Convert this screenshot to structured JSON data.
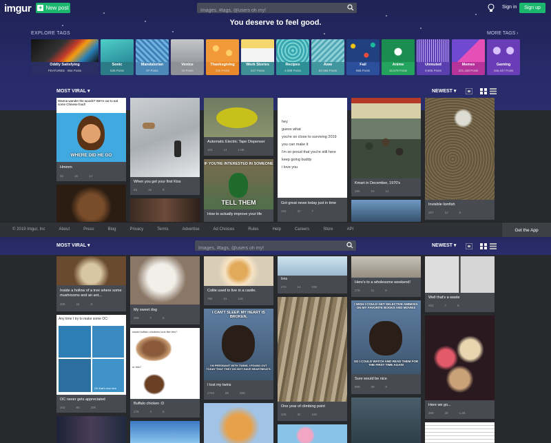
{
  "topbar": {
    "logo": "imgur",
    "new_post_label": "New post",
    "search_placeholder": "Images, #tags, @users oh my!",
    "sign_in": "Sign in",
    "sign_up": "Sign up"
  },
  "hero": {
    "tagline": "You deserve to feel good.",
    "explore_label": "EXPLORE TAGS",
    "more_tags_label": "MORE TAGS"
  },
  "tags": [
    {
      "label": "Oddly Satisfying",
      "count": "FEATURED · 864 Posts",
      "color": "#2a2f63"
    },
    {
      "label": "Sonic",
      "count": "535 Posts",
      "color": "#2c7c87"
    },
    {
      "label": "Mandalorian",
      "count": "97 Posts",
      "color": "#4c89b9"
    },
    {
      "label": "Venice",
      "count": "15 Posts",
      "color": "#8e9196"
    },
    {
      "label": "Thanksgiving",
      "count": "226 Posts",
      "color": "#e98a2a"
    },
    {
      "label": "Work Stories",
      "count": "247 Posts",
      "color": "#3f9096"
    },
    {
      "label": "Recipes",
      "count": "4,898 Posts",
      "color": "#2e8f97"
    },
    {
      "label": "Aww",
      "count": "50,566 Posts",
      "color": "#4196a0"
    },
    {
      "label": "Fail",
      "count": "868 Posts",
      "color": "#2b4f9a"
    },
    {
      "label": "Anime",
      "count": "16,579 Posts",
      "color": "#24a35f"
    },
    {
      "label": "Unmuted",
      "count": "9,805 Posts",
      "color": "#5a3fb0"
    },
    {
      "label": "Memes",
      "count": "221,158 Posts",
      "color": "#b5339b"
    },
    {
      "label": "Gaming",
      "count": "156,447 Posts",
      "color": "#6a3cb6"
    }
  ],
  "sort": {
    "most_viral": "MOST VIRAL",
    "newest": "NEWEST"
  },
  "footer": {
    "links": [
      "© 2019 Imgur, Inc",
      "About",
      "Press",
      "Blog",
      "Privacy",
      "Terms",
      "Advertise",
      "Ad Choices",
      "Rules",
      "Help",
      "Careers",
      "Store",
      "API"
    ],
    "get_app": "Get the App"
  },
  "posts": {
    "c1a": {
      "title": "Hmmm",
      "meta": [
        "92",
        "16",
        "14"
      ]
    },
    "c2a": {
      "title": "When you get your first Kiss",
      "meta": [
        "63",
        "16",
        "9"
      ]
    },
    "c3a": {
      "title": "Automatic Electric Tape Dispenser",
      "meta": [
        "103",
        "14",
        "1.9K"
      ]
    },
    "c3b": {
      "title": "How to actually improve your life",
      "meta": [
        "141",
        "40",
        "6"
      ]
    },
    "c4a": {
      "title": "Got great news today just in time",
      "meta": [
        "102",
        "31",
        "7"
      ]
    },
    "c5a": {
      "title": "Kmart in December, 1970's",
      "meta": [
        "290",
        "15",
        "14"
      ]
    },
    "c6a": {
      "title": "Invisible lionfish",
      "meta": [
        "257",
        "12",
        "8"
      ]
    },
    "c1b": {
      "title": "Inside a hollow of a tree where some mushrooms and an ant...",
      "meta": [
        "406",
        "22",
        "8"
      ]
    },
    "c2b": {
      "title": "My sweet dog",
      "meta": [
        "309",
        "7",
        "6"
      ]
    },
    "c3c": {
      "title": "Collie used to live in a castle.",
      "meta": [
        "782",
        "21",
        "11K"
      ]
    },
    "c3d": {
      "title": "I lost my twins",
      "meta": [
        "2703",
        "88",
        "30K"
      ]
    },
    "c4b": {
      "title": "Irns",
      "meta": [
        "470",
        "14",
        "19K"
      ]
    },
    "c4c": {
      "title": "One year of climbing point",
      "meta": [
        "345",
        "31",
        "15K"
      ]
    },
    "c5b": {
      "title": "Here's to a wholesome weekend!",
      "meta": [
        "279",
        "11",
        "6"
      ]
    },
    "c5c": {
      "title": "Sure would be nice",
      "meta": [
        "909",
        "39",
        "8"
      ]
    },
    "c6b": {
      "title": "Well that's a waste",
      "meta": [
        "204",
        "7",
        "9"
      ]
    },
    "c6c": {
      "title": "Here we go...",
      "meta": [
        "308",
        "29",
        "1.3K"
      ]
    },
    "c1c": {
      "title": "OC never gets appreciated",
      "meta": [
        "342",
        "85",
        "20K"
      ]
    },
    "c2c": {
      "title": "Buffalo chicken :D",
      "meta": [
        "176",
        "4",
        "6"
      ]
    }
  },
  "memes": {
    "dora_top": "Wanna wander the woods? We're out to eat some Chinese food!",
    "dora_bottom": "WHERE DID HE GO",
    "duck_top": "IF YOU'RE INTERESTED IN SOMEONE",
    "duck_bottom": "TELL THEM",
    "note_lines": [
      "hey",
      "guess what",
      "you're so close to surviving 2019",
      "you can make it",
      "i'm so proud that you're still here",
      "keep going buddy",
      "i love you"
    ],
    "bear_top": "I CAN'T SLEEP. MY HEART IS BROKEN.",
    "bear_bottom": "I'M PREGNANT WITH TWINS. I FOUND OUT TODAY THAT THEY DO NOT HAVE HEARTBEATS.",
    "bear2_top": "I WISH I COULD GET SELECTIVE AMNESIA ON MY FAVORITE BOOKS AND MOVIES",
    "bear2_bottom": "SO I COULD WATCH AND READ THEM FOR THE FIRST TIME AGAIN",
    "oc_top": "Any time I try to make some OC:",
    "oc_caption": "Oh that's real nice",
    "buffalo_top": "would buffalo chickens look like this?",
    "buffalo_q": "or this?"
  }
}
